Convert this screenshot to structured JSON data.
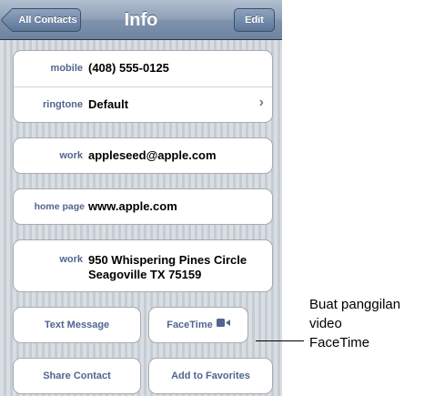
{
  "navbar": {
    "back_label": "All Contacts",
    "title": "Info",
    "edit_label": "Edit"
  },
  "phone_group": {
    "rows": [
      {
        "label": "mobile",
        "value": "(408) 555-0125"
      },
      {
        "label": "ringtone",
        "value": "Default"
      }
    ]
  },
  "email": {
    "label": "work",
    "value": "appleseed@apple.com"
  },
  "homepage": {
    "label": "home page",
    "value": "www.apple.com"
  },
  "address": {
    "label": "work",
    "line1": "950 Whispering Pines Circle",
    "line2": "Seagoville TX 75159"
  },
  "actions": {
    "text_message": "Text Message",
    "facetime": "FaceTime",
    "share_contact": "Share Contact",
    "add_favorites": "Add to Favorites"
  },
  "annotation": {
    "line1": "Buat panggilan",
    "line2": "video",
    "line3": "FaceTime"
  },
  "colors": {
    "label_blue": "#50658f",
    "nav_gradient_mid": "#7f93ad"
  }
}
